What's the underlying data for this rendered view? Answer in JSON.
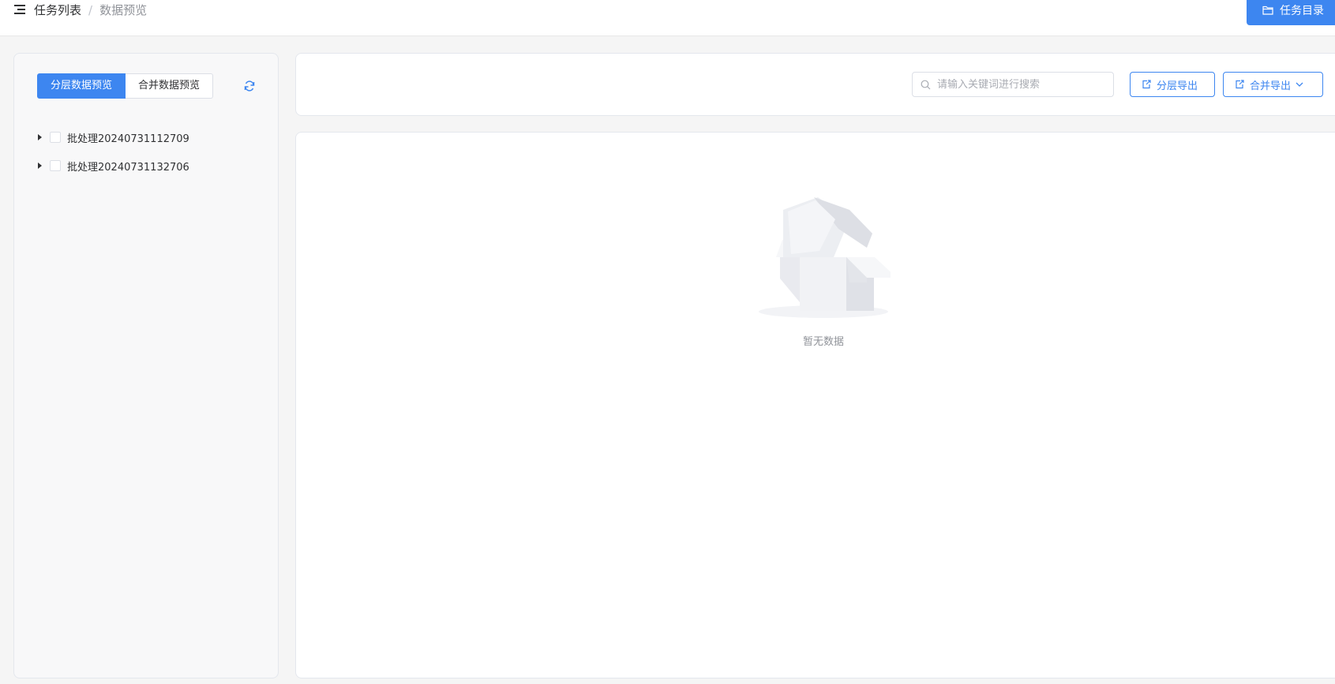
{
  "header": {
    "breadcrumb_root": "任务列表",
    "breadcrumb_sep": "/",
    "breadcrumb_current": "数据预览",
    "task_dir_button": "任务目录"
  },
  "left": {
    "tabs": [
      {
        "label": "分层数据预览",
        "active": true
      },
      {
        "label": "合并数据预览",
        "active": false
      }
    ],
    "tree": [
      {
        "label": "批处理20240731112709",
        "checked": false,
        "expanded": false
      },
      {
        "label": "批处理20240731132706",
        "checked": false,
        "expanded": false
      }
    ]
  },
  "toolbar": {
    "search_placeholder": "请输入关键词进行搜索",
    "layer_export": "分层导出",
    "merge_export": "合并导出"
  },
  "main": {
    "empty_text": "暂无数据"
  },
  "colors": {
    "primary": "#3d86f0",
    "border": "#e4e7ed",
    "background": "#f5f5f5"
  }
}
